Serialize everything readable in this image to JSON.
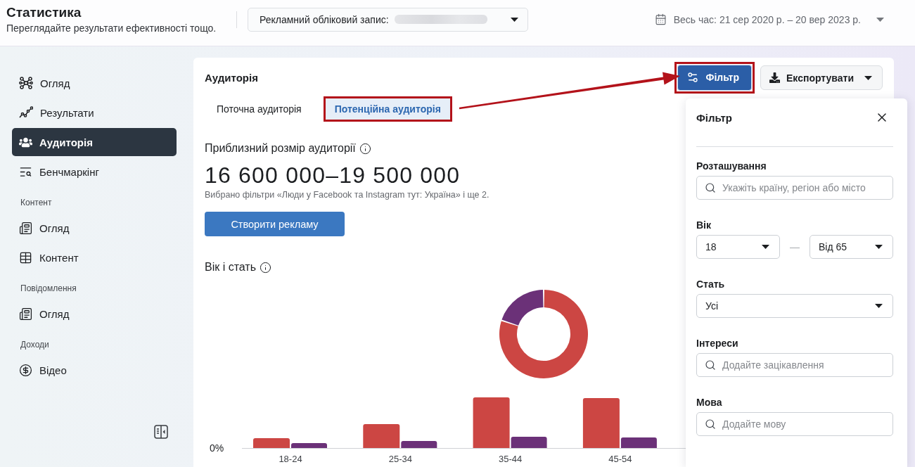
{
  "header": {
    "title": "Статистика",
    "subtitle": "Переглядайте результати ефективності тощо.",
    "account_selector": {
      "label": "Рекламний обліковий запис:"
    },
    "date_range": "Весь час: 21 сер 2020 р. – 20 вер 2023 р."
  },
  "sidebar": {
    "items": [
      {
        "kind": "link",
        "label": "Огляд",
        "selected": false
      },
      {
        "kind": "link",
        "label": "Результати",
        "selected": false
      },
      {
        "kind": "link",
        "label": "Аудиторія",
        "selected": true
      },
      {
        "kind": "link",
        "label": "Бенчмаркінг",
        "selected": false
      },
      {
        "kind": "heading",
        "label": "Контент"
      },
      {
        "kind": "link",
        "label": "Огляд",
        "selected": false
      },
      {
        "kind": "link",
        "label": "Контент",
        "selected": false
      },
      {
        "kind": "heading",
        "label": "Повідомлення"
      },
      {
        "kind": "link",
        "label": "Огляд",
        "selected": false
      },
      {
        "kind": "heading",
        "label": "Доходи"
      },
      {
        "kind": "link",
        "label": "Відео",
        "selected": false
      }
    ]
  },
  "card": {
    "title": "Аудиторія",
    "filter_button": {
      "label": "Фільтр",
      "highlighted": true
    },
    "export_button": {
      "label": "Експортувати"
    },
    "tabs": [
      {
        "label": "Поточна аудиторія",
        "selected": false,
        "highlighted": false
      },
      {
        "label": "Потенційна аудиторія",
        "selected": true,
        "highlighted": true
      }
    ],
    "audience_size": {
      "heading": "Приблизний розмір аудиторії",
      "value": "16 600 000–19 500 000",
      "note": "Вибрано фільтри «Люди у Facebook та Instagram тут: Україна» і ще 2.",
      "button": "Створити рекламу"
    },
    "age_gender": {
      "heading": "Вік і стать",
      "zero_label": "0%",
      "categories": [
        "18-24",
        "25-34",
        "35-44",
        "45-54"
      ]
    }
  },
  "filter_panel": {
    "title": "Фільтр",
    "fields": [
      {
        "kind": "search",
        "label": "Розташування",
        "placeholder": "Укажіть країну, регіон або місто"
      },
      {
        "kind": "range",
        "label": "Вік",
        "from": "18",
        "to": "Від 65",
        "separator": "—"
      },
      {
        "kind": "select",
        "label": "Стать",
        "value": "Усі"
      },
      {
        "kind": "search",
        "label": "Інтереси",
        "placeholder": "Додайте зацікавлення"
      },
      {
        "kind": "search",
        "label": "Мова",
        "placeholder": "Додайте мову"
      }
    ]
  }
}
